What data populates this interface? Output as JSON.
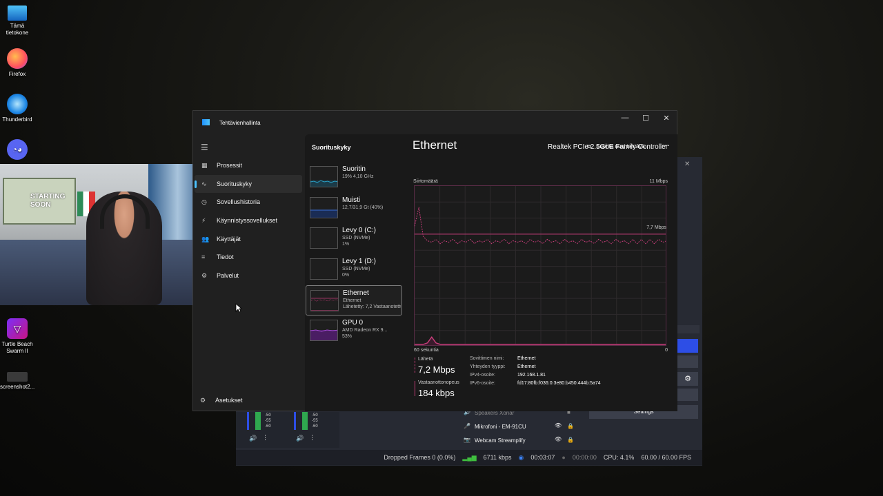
{
  "desktop": {
    "icons": [
      {
        "label": "Tämä tietokone",
        "icon": "monitor-icon"
      },
      {
        "label": "Firefox",
        "icon": "firefox-icon"
      },
      {
        "label": "Thunderbird",
        "icon": "thunderbird-icon"
      },
      {
        "label": "Discord",
        "icon": "discord-icon"
      },
      {
        "label": "Turtle Beach Swarm II",
        "icon": "turtle-beach-icon"
      },
      {
        "label": "screenshot2...",
        "icon": "screenshot-file-icon"
      }
    ]
  },
  "webcam": {
    "sign_text": "STARTING SOON"
  },
  "obs": {
    "mixer_levels": [
      "-50",
      "-55",
      "-60"
    ],
    "sources": [
      {
        "label": "Speakers Xonar"
      },
      {
        "label": "Mikrofoni - EM-91CU"
      },
      {
        "label": "Webcam Streamplify"
      }
    ],
    "settings_label": "Settings",
    "status": {
      "dropped_frames": "Dropped Frames 0 (0.0%)",
      "bitrate": "6711 kbps",
      "stream_time": "00:03:07",
      "record_time": "00:00:00",
      "cpu": "CPU: 4.1%",
      "fps": "60.00 / 60.00 FPS"
    }
  },
  "taskmanager": {
    "title": "Tehtävienhallinta",
    "window_controls": {
      "minimize": "—",
      "maximize": "☐",
      "close": "✕"
    },
    "nav": [
      {
        "label": "Prosessit",
        "icon": "processes-icon"
      },
      {
        "label": "Suorituskyky",
        "icon": "performance-icon",
        "active": true
      },
      {
        "label": "Sovellushistoria",
        "icon": "app-history-icon"
      },
      {
        "label": "Käynnistyssovellukset",
        "icon": "startup-apps-icon"
      },
      {
        "label": "Käyttäjät",
        "icon": "users-icon"
      },
      {
        "label": "Tiedot",
        "icon": "details-icon"
      },
      {
        "label": "Palvelut",
        "icon": "services-icon"
      }
    ],
    "settings_label": "Asetukset",
    "header": {
      "title": "Suorituskyky",
      "run_task": "Suorita uusi tehtävä"
    },
    "resources": [
      {
        "name": "Suoritin",
        "line2": "19% 4,10 GHz",
        "line3": "",
        "color": "#2aa3c9",
        "fill": "#1b3b48"
      },
      {
        "name": "Muisti",
        "line2": "12,7/31,9 Gt (40%)",
        "line3": "",
        "color": "#3a6ed6",
        "fill": "#1a2c55"
      },
      {
        "name": "Levy 0 (C:)",
        "line2": "SSD (NVMe)",
        "line3": "1%",
        "color": "#6abf4b",
        "fill": "#2a2a2a"
      },
      {
        "name": "Levy 1 (D:)",
        "line2": "SSD (NVMe)",
        "line3": "0%",
        "color": "#6abf4b",
        "fill": "#2a2a2a"
      },
      {
        "name": "Ethernet",
        "line2": "Ethernet",
        "line3": "Lähetetty: 7,2 Vastaanotettu: 184 kbps",
        "color": "#c73d7a",
        "fill": "#2a1a22",
        "active": true
      },
      {
        "name": "GPU 0",
        "line2": "AMD Radeon RX 9...",
        "line3": "53%",
        "color": "#a24bd1",
        "fill": "#4a1d63"
      }
    ],
    "detail": {
      "title": "Ethernet",
      "adapter": "Realtek PCIe 2.5GbE Family Controller",
      "throughput_label": "Siirtomäärä",
      "max_label": "11 Mbps",
      "ref_label": "7,7 Mbps",
      "time_label": "60 sekuntia",
      "zero_label": "0",
      "send_label": "Lähetä",
      "send_value": "7,2 Mbps",
      "recv_label": "Vastaanottonopeus",
      "recv_value": "184 kbps",
      "info": [
        {
          "k": "Sovittimen nimi:",
          "v": "Ethernet"
        },
        {
          "k": "Yhteyden tyyppi:",
          "v": "Ethernet"
        },
        {
          "k": "IPv4-osoite:",
          "v": "192.168.1.81"
        },
        {
          "k": "IPv6-osoite:",
          "v": "fd17:80fb:f036:0:3e80:b450:444b:5a74"
        }
      ]
    },
    "chart_data": {
      "type": "line",
      "xlabel": "60 sekuntia",
      "ylim": [
        0,
        11
      ],
      "series": [
        {
          "values": [
            8.2,
            9.5,
            7.5,
            7.2,
            7.1,
            7.3,
            7.0,
            7.2,
            7.1,
            7.3,
            7.0,
            7.2,
            7.1,
            7.3,
            7.0,
            7.2,
            7.1,
            7.3,
            7.0,
            7.2,
            7.1,
            7.3,
            7.0,
            7.2,
            7.1,
            7.2,
            7.0,
            7.3,
            7.1,
            7.2,
            7.0,
            7.3,
            7.1,
            7.2,
            7.0,
            7.3,
            7.1,
            7.2,
            7.0,
            7.3,
            7.1,
            7.2,
            7.0,
            7.3,
            7.1,
            7.2,
            7.0,
            7.3,
            7.1,
            7.2,
            7.0,
            7.3,
            7.0,
            7.3,
            7.0,
            7.3,
            7.0,
            7.3,
            7.1,
            7.2
          ]
        },
        {
          "values": [
            0.1,
            0.1,
            0.1,
            0.2,
            0.6,
            0.2,
            0.1,
            0.1,
            0.1,
            0.1,
            0.1,
            0.1,
            0.1,
            0.1,
            0.1,
            0.1,
            0.1,
            0.1,
            0.1,
            0.1,
            0.1,
            0.1,
            0.1,
            0.1,
            0.1,
            0.1,
            0.1,
            0.1,
            0.1,
            0.1,
            0.1,
            0.1,
            0.1,
            0.1,
            0.1,
            0.1,
            0.1,
            0.1,
            0.1,
            0.1,
            0.1,
            0.1,
            0.1,
            0.1,
            0.1,
            0.1,
            0.1,
            0.1,
            0.1,
            0.1,
            0.1,
            0.1,
            0.1,
            0.1,
            0.1,
            0.1,
            0.1,
            0.1,
            0.1,
            0.1
          ]
        }
      ]
    }
  },
  "colors": {
    "accent": "#4cc2ff",
    "ethernet": "#c73d7a"
  }
}
